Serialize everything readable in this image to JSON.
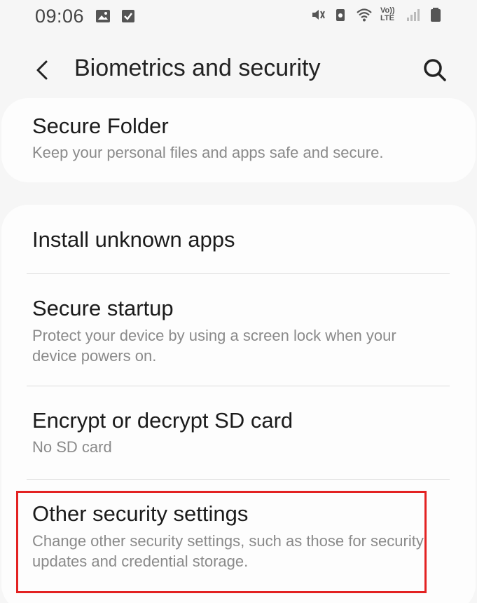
{
  "status_bar": {
    "time": "09:06",
    "left_icons": [
      "image-icon",
      "checkbox-icon"
    ],
    "right_icons": [
      "mute-icon",
      "data-saver-icon",
      "wifi-icon",
      "volte-icon",
      "signal-icon",
      "battery-icon"
    ],
    "volte_label": "Vo)) LTE"
  },
  "app_bar": {
    "title": "Biometrics and security"
  },
  "top_card": {
    "title": "Secure Folder",
    "subtitle": "Keep your personal files and apps safe and secure."
  },
  "items": [
    {
      "title": "Install unknown apps",
      "subtitle": ""
    },
    {
      "title": "Secure startup",
      "subtitle": "Protect your device by using a screen lock when your device powers on."
    },
    {
      "title": "Encrypt or decrypt SD card",
      "subtitle": "No SD card"
    },
    {
      "title": "Other security settings",
      "subtitle": "Change other security settings, such as those for security updates and credential storage."
    }
  ],
  "colors": {
    "background": "#f6f6f6",
    "card": "#fdfdfd",
    "highlight": "#e32222"
  }
}
